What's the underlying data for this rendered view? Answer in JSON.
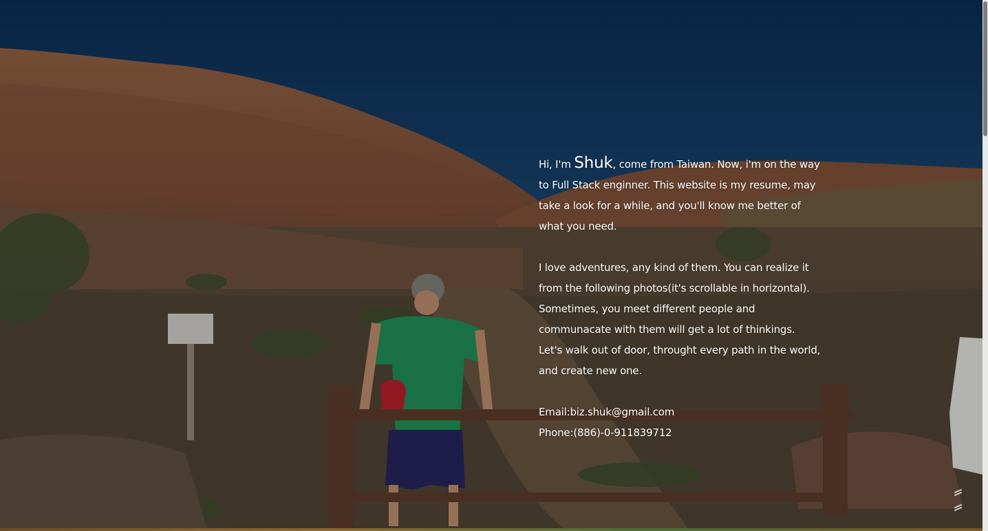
{
  "intro": {
    "greeting_prefix": "Hi, I'm ",
    "name": "Shuk",
    "greeting_suffix": ", come from Taiwan. Now, i'm on the way to Full Stack enginner. This website is my resume, may take a look for a while, and you'll know me better of what you need.",
    "adventure_paragraph": "I love adventures, any kind of them. You can realize it from the following photos(it's scrollable in horizontal). Sometimes, you meet different people and communacate with them will get a lot of thinkings. Let's walk out of door, throught every path in the world, and create new one.",
    "email_line": "Email:biz.shuk@gmail.com",
    "phone_line": "Phone:(886)-0-911839712"
  },
  "icons": {
    "scroll_hint": "double-chevron-down-icon"
  },
  "colors": {
    "text": "#ffffff",
    "sky": "#163e68",
    "rock": "#8a5a3c"
  }
}
